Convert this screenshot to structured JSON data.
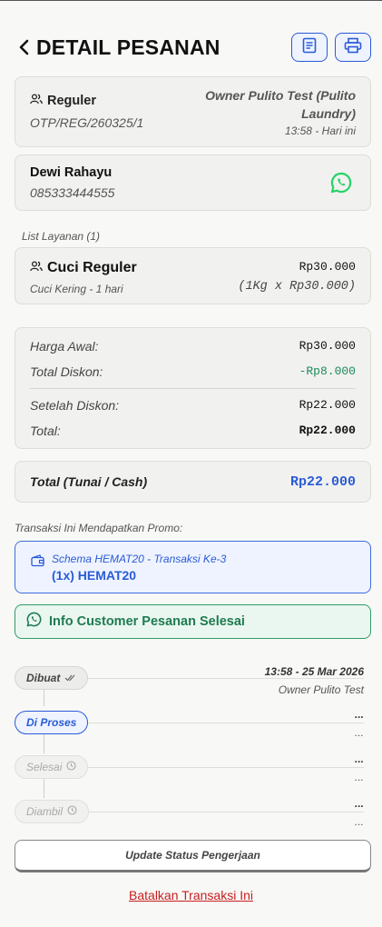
{
  "header": {
    "title": "DETAIL PESANAN"
  },
  "order": {
    "type": "Reguler",
    "id": "OTP/REG/260325/1",
    "owner": "Owner Pulito Test (Pulito Laundry)",
    "time": "13:58 - Hari ini"
  },
  "customer": {
    "name": "Dewi Rahayu",
    "phone": "085333444555"
  },
  "services": {
    "label": "List Layanan (1)",
    "items": [
      {
        "name": "Cuci Reguler",
        "sub": "Cuci Kering - 1 hari",
        "price": "Rp30.000",
        "calc": "(1Kg x Rp30.000)"
      }
    ]
  },
  "summary": {
    "harga_awal_label": "Harga Awal:",
    "harga_awal": "Rp30.000",
    "diskon_label": "Total Diskon:",
    "diskon": "-Rp8.000",
    "setelah_label": "Setelah Diskon:",
    "setelah": "Rp22.000",
    "total_label": "Total:",
    "total": "Rp22.000"
  },
  "payment": {
    "label": "Total (Tunai / Cash)",
    "value": "Rp22.000"
  },
  "promo": {
    "section_label": "Transaksi Ini Mendapatkan Promo:",
    "schema": "Schema HEMAT20 - Transaksi Ke-3",
    "code": "(1x) HEMAT20"
  },
  "info_button": "Info Customer Pesanan Selesai",
  "timeline": [
    {
      "status": "Dibuat",
      "state": "done",
      "date": "13:58 - 25 Mar 2026",
      "by": "Owner Pulito Test"
    },
    {
      "status": "Di Proses",
      "state": "active",
      "date": "...",
      "by": "..."
    },
    {
      "status": "Selesai",
      "state": "pending",
      "date": "...",
      "by": "..."
    },
    {
      "status": "Diambil",
      "state": "pending",
      "date": "...",
      "by": "..."
    }
  ],
  "update_button": "Update Status Pengerjaan",
  "cancel_link": "Batalkan Transaksi Ini",
  "colors": {
    "accent": "#2a5bd7",
    "green": "#1f7a50",
    "whatsapp": "#25d366",
    "danger": "#c81e1e"
  }
}
